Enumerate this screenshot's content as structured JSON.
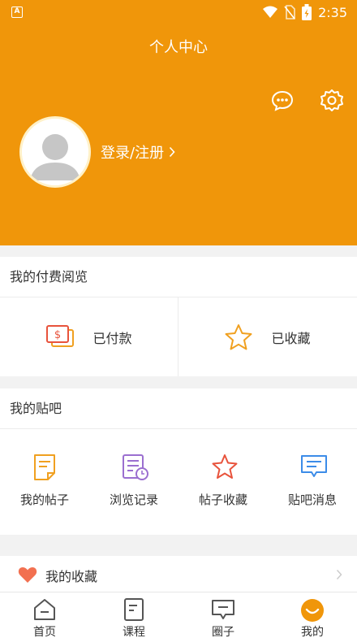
{
  "status_bar": {
    "time": "2:35",
    "app_icon_text": "A"
  },
  "header": {
    "title": "个人中心",
    "login_text": "登录/注册"
  },
  "paid_section": {
    "title": "我的付费阅览",
    "items": [
      {
        "label": "已付款",
        "icon": "payment-icon"
      },
      {
        "label": "已收藏",
        "icon": "star-icon"
      }
    ]
  },
  "tieba_section": {
    "title": "我的贴吧",
    "items": [
      {
        "label": "我的帖子",
        "icon": "document-icon"
      },
      {
        "label": "浏览记录",
        "icon": "history-icon"
      },
      {
        "label": "帖子收藏",
        "icon": "star-icon"
      },
      {
        "label": "贴吧消息",
        "icon": "message-icon"
      }
    ]
  },
  "favorites": {
    "label": "我的收藏",
    "icon": "heart-icon"
  },
  "tabbar": {
    "items": [
      {
        "label": "首页",
        "icon": "home-icon"
      },
      {
        "label": "课程",
        "icon": "course-icon"
      },
      {
        "label": "圈子",
        "icon": "circle-icon"
      },
      {
        "label": "我的",
        "icon": "profile-icon",
        "active": true
      }
    ]
  },
  "colors": {
    "accent": "#f0960a",
    "icon_orange": "#f0a020",
    "icon_purple": "#9b6fd0",
    "icon_red": "#e8533c",
    "icon_blue": "#3c8ce8",
    "heart": "#f27050"
  }
}
